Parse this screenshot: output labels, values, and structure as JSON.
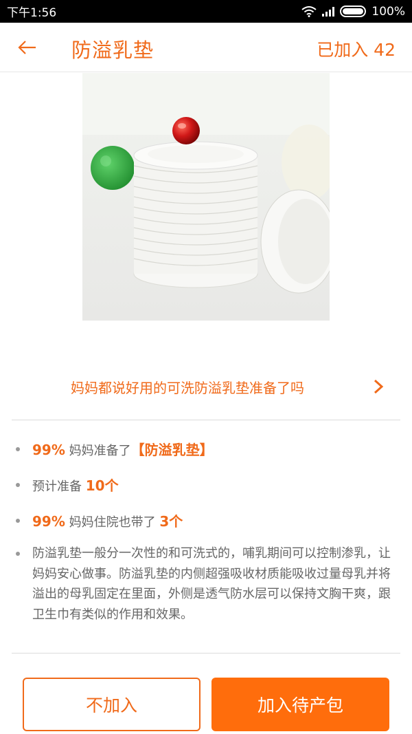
{
  "status": {
    "time": "下午1:56",
    "battery": "100%"
  },
  "header": {
    "back_icon": "arrow-left-icon",
    "title": "防溢乳垫",
    "added_label": "已加入 42"
  },
  "hero": {
    "alt_icon": "product-photo"
  },
  "link": {
    "text": "妈妈都说好用的可洗防溢乳垫准备了吗",
    "icon": "chevron-right-icon"
  },
  "facts": [
    {
      "highlight": "99%",
      "text": " 妈妈准备了",
      "highlight2": "【防溢乳垫】"
    },
    {
      "text": "预计准备 ",
      "highlight": "10个"
    },
    {
      "highlight": "99%",
      "text": " 妈妈住院也带了 ",
      "highlight2": "3个"
    }
  ],
  "description": "防溢乳垫一般分一次性的和可洗式的，哺乳期间可以控制渗乳，让妈妈安心做事。防溢乳垫的内侧超强吸收材质能吸收过量母乳并将溢出的母乳固定在里面，外侧是透气防水层可以保持文胸干爽，跟卫生巾有类似的作用和效果。",
  "buttons": {
    "decline": "不加入",
    "accept": "加入待产包"
  },
  "colors": {
    "accent": "#f06a1a",
    "button_fill": "#ff6d0c"
  }
}
